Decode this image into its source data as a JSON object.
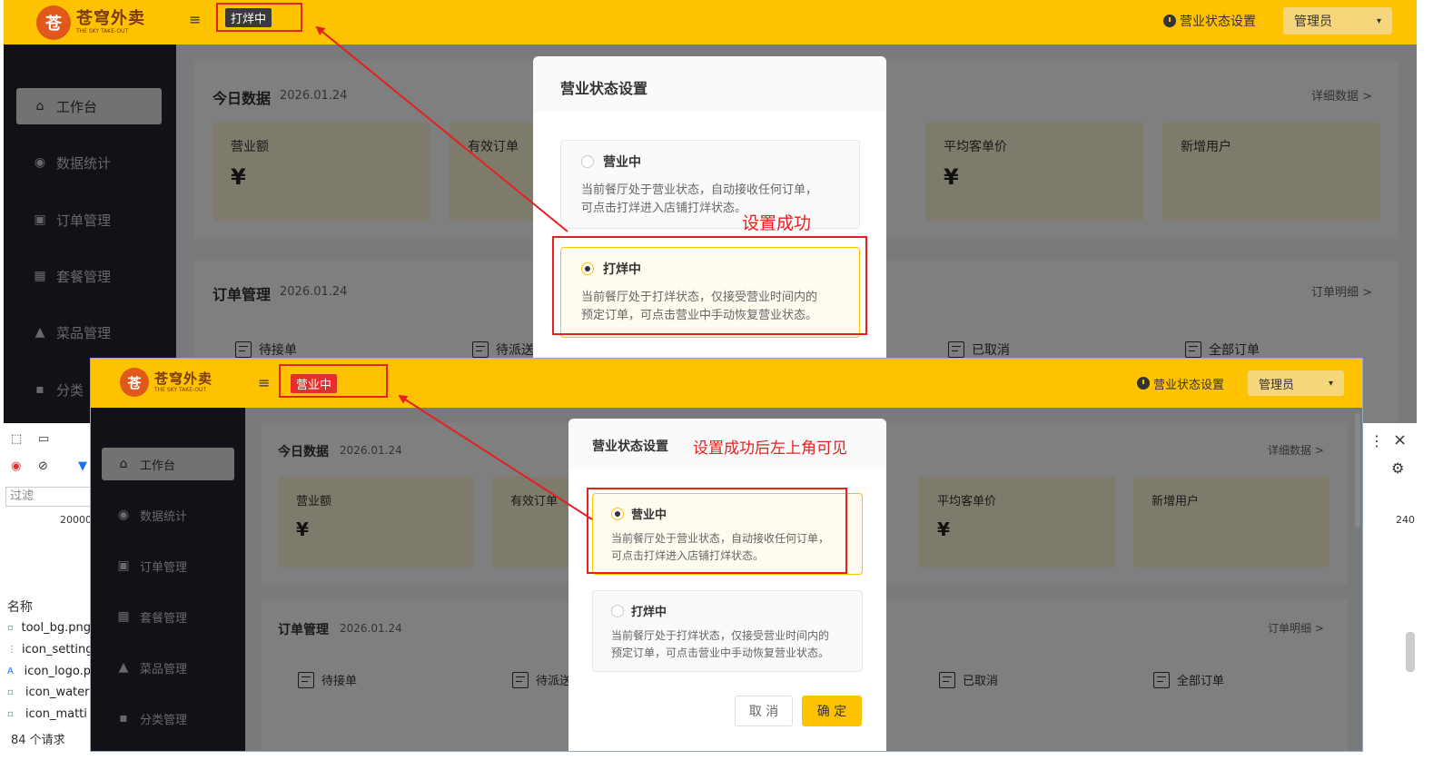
{
  "app": {
    "logo_cn": "苍穹外卖",
    "logo_en": "THE SKY TAKE-OUT",
    "logo_badge": "苍",
    "menu_icon": "≡",
    "status_setting_label": "营业状态设置",
    "admin_label": "管理员",
    "admin_arrow": "▾"
  },
  "sidebar": {
    "items": [
      {
        "label": "工作台",
        "icon": "⌂"
      },
      {
        "label": "数据统计",
        "icon": "◉"
      },
      {
        "label": "订单管理",
        "icon": "▣"
      },
      {
        "label": "套餐管理",
        "icon": "▦"
      },
      {
        "label": "菜品管理",
        "icon": "▲"
      },
      {
        "label": "分类管理",
        "icon": "▪"
      }
    ],
    "top_partial_label": "分类"
  },
  "dashboard": {
    "today_title": "今日数据",
    "today_date": "2026.01.24",
    "today_link": "详细数据  >",
    "stats": [
      "营业额",
      "有效订单",
      "平均客单价",
      "新增用户"
    ],
    "currency": "¥",
    "order_title": "订单管理",
    "order_date": "2026.01.24",
    "order_link": "订单明细  >",
    "orders": [
      "待接单",
      "待派送",
      "已取消",
      "全部订单"
    ]
  },
  "top_screen": {
    "status_tag": "打烊中",
    "dialog": {
      "title": "营业状态设置",
      "options": [
        {
          "title": "营业中",
          "desc1": "当前餐厅处于营业状态，自动接收任何订单，",
          "desc2": "可点击打烊进入店铺打烊状态。",
          "selected": false
        },
        {
          "title": "打烊中",
          "desc1": "当前餐厅处于打烊状态，仅接受营业时间内的",
          "desc2": "预定订单，可点击营业中手动恢复营业状态。",
          "selected": true
        }
      ]
    },
    "annotation": "设置成功"
  },
  "bottom_screen": {
    "status_tag": "营业中",
    "dialog": {
      "title": "营业状态设置",
      "options": [
        {
          "title": "营业中",
          "desc1": "当前餐厅处于营业状态，自动接收任何订单，",
          "desc2": "可点击打烊进入店铺打烊状态。",
          "selected": true
        },
        {
          "title": "打烊中",
          "desc1": "当前餐厅处于打烊状态，仅接受营业时间内的",
          "desc2": "预定订单，可点击营业中手动恢复营业状态。",
          "selected": false
        }
      ],
      "cancel": "取 消",
      "confirm": "确 定"
    },
    "annotation": "设置成功后左上角可见"
  },
  "devtools": {
    "filter_placeholder": "过滤",
    "value_left": "20000",
    "value_right": "240",
    "name_header": "名称",
    "files": [
      "tool_bg.png",
      "icon_setting",
      "icon_logo.p",
      "icon_water",
      "icon_matti"
    ],
    "request_count": "84 个请求",
    "close": "×",
    "more": "⋮",
    "gear": "⚙"
  },
  "colors": {
    "brand_yellow": "#ffc200",
    "sidebar_dark": "#22242e",
    "annotation_red": "#e52020",
    "closed_tag": "#3a3a3a",
    "open_tag": "#e0322c"
  }
}
